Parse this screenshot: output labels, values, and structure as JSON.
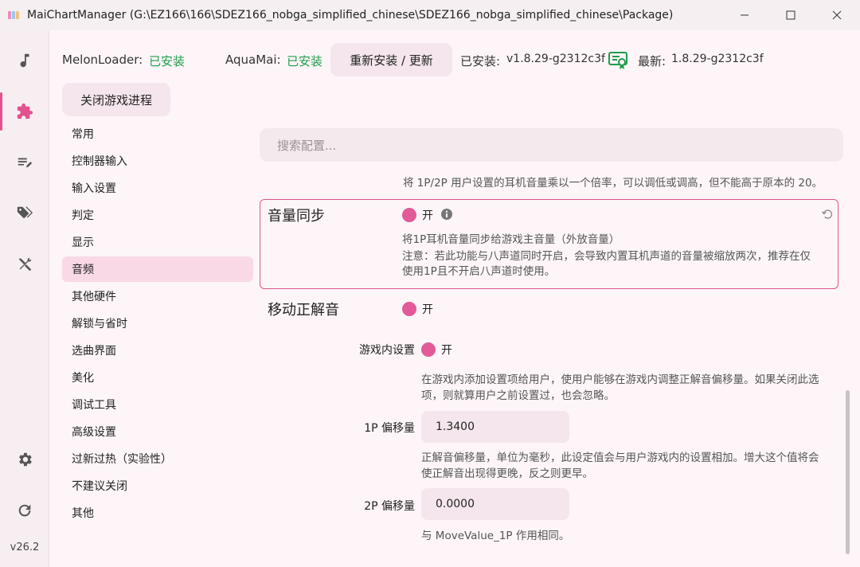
{
  "window": {
    "title": "MaiChartManager (G:\\EZ166\\166\\SDEZ166_nobga_simplified_chinese\\SDEZ166_nobga_simplified_chinese\\Package)"
  },
  "rail": {
    "version": "v26.2"
  },
  "header": {
    "melonloader_label": "MelonLoader:",
    "melonloader_status": "已安装",
    "aquamai_label": "AquaMai:",
    "aquamai_status": "已安装",
    "reinstall_button": "重新安装 / 更新",
    "installed_label": "已安装:",
    "installed_version": "v1.8.29-g2312c3f",
    "latest_label": "最新:",
    "latest_version": "1.8.29-g2312c3f",
    "close_game_button": "关闭游戏进程"
  },
  "nav": {
    "items": [
      "常用",
      "控制器输入",
      "输入设置",
      "判定",
      "显示",
      "音频",
      "其他硬件",
      "解锁与省时",
      "选曲界面",
      "美化",
      "调试工具",
      "高级设置",
      "过新过热（实验性）",
      "不建议关闭",
      "其他"
    ],
    "active_index": 5
  },
  "search": {
    "placeholder": "搜索配置..."
  },
  "content": {
    "prev_desc": "将 1P/2P 用户设置的耳机音量乘以一个倍率，可以调低或调高，但不能高于原本的 20。",
    "volume_sync": {
      "title": "音量同步",
      "toggle_label": "开",
      "desc_line1": "将1P耳机音量同步给游戏主音量（外放音量）",
      "desc_line2": "注意：若此功能与八声道同时开启，会导致内置耳机声道的音量被缩放两次，推荐在仅",
      "desc_line3": "使用1P且不开启八声道时使用。"
    },
    "move_answer": {
      "title": "移动正解音",
      "toggle_label": "开",
      "in_game_label": "游戏内设置",
      "in_game_toggle": "开",
      "in_game_desc1": "在游戏内添加设置项给用户，使用户能够在游戏内调整正解音偏移量。如果关闭此选",
      "in_game_desc2": "项，则就算用户之前设置过，也会忽略。",
      "p1_label": "1P 偏移量",
      "p1_value": "1.3400",
      "p1_desc1": "正解音偏移量，单位为毫秒，此设定值会与用户游戏内的设置相加。增大这个值将会",
      "p1_desc2": "使正解音出现得更晚，反之则更早。",
      "p2_label": "2P 偏移量",
      "p2_value": "0.0000",
      "p2_desc": "与 MoveValue_1P 作用相同。"
    }
  },
  "colors": {
    "accent": "#e2528e",
    "ok_green": "#1f9d4a"
  }
}
